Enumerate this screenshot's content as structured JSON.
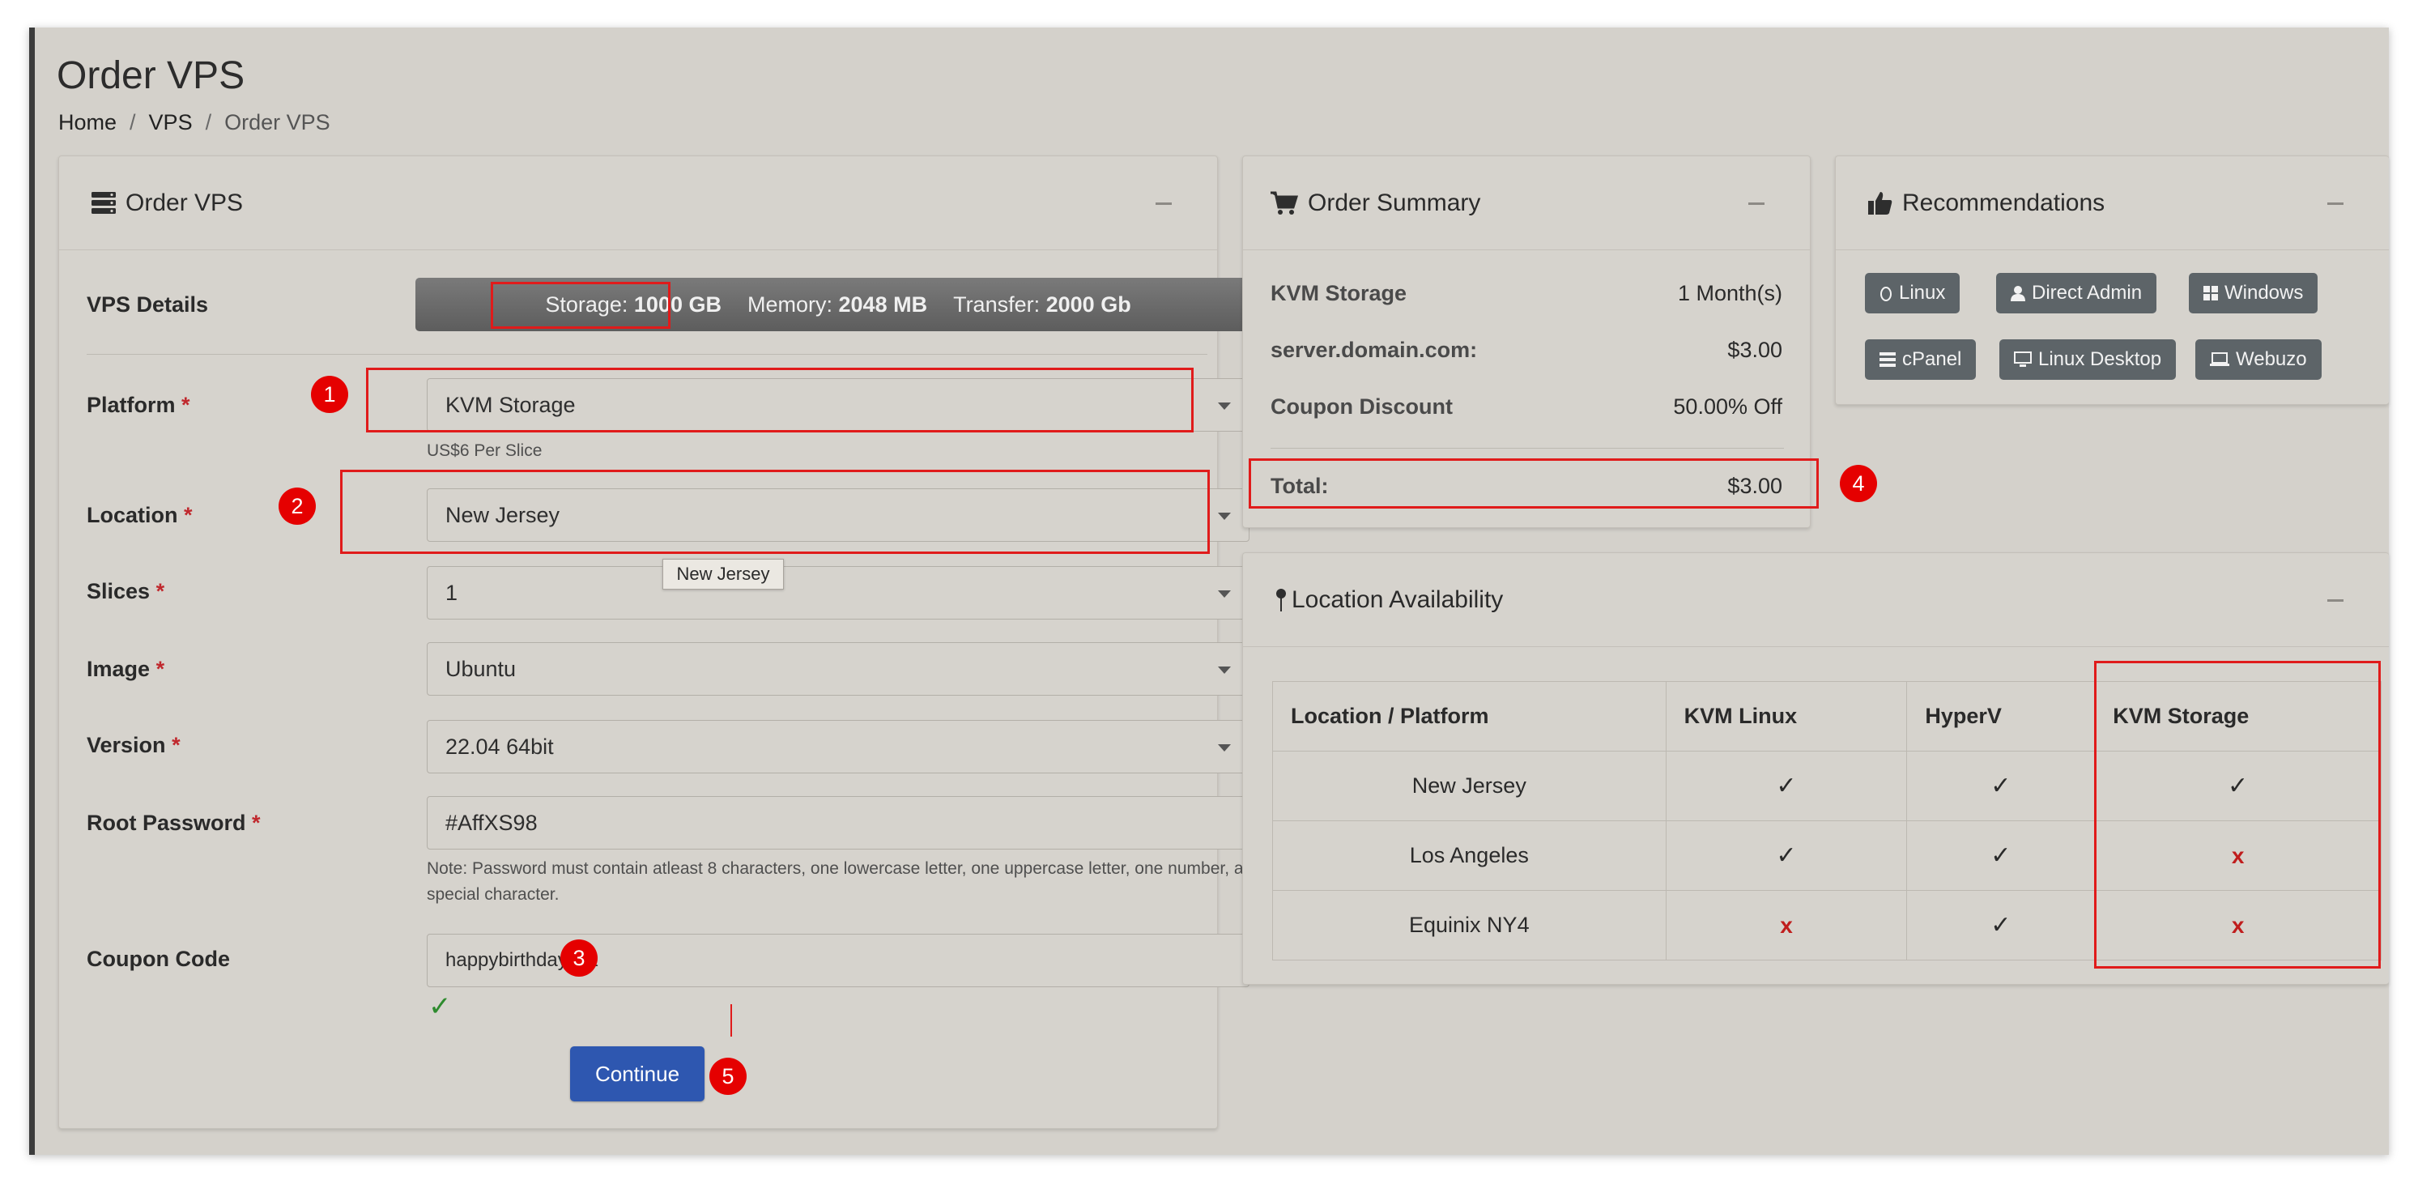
{
  "page": {
    "title": "Order VPS",
    "breadcrumb": [
      "Home",
      "VPS",
      "Order VPS"
    ],
    "breadcrumb_sep": "/"
  },
  "order_card": {
    "title": "Order VPS",
    "vps_details_label": "VPS Details",
    "storage_label": "Storage:",
    "storage_value": "1000 GB",
    "memory_label": "Memory:",
    "memory_value": "2048 MB",
    "transfer_label": "Transfer:",
    "transfer_value": "2000 Gb",
    "required_mark": "*",
    "platform": {
      "label": "Platform",
      "value": "KVM Storage",
      "help": "US$6 Per Slice"
    },
    "location": {
      "label": "Location",
      "value": "New Jersey",
      "tooltip": "New Jersey"
    },
    "slices": {
      "label": "Slices",
      "value": "1"
    },
    "image": {
      "label": "Image",
      "value": "Ubuntu"
    },
    "version": {
      "label": "Version",
      "value": "22.04 64bit"
    },
    "root_password": {
      "label": "Root Password",
      "value": "#AffXS98",
      "note_line1": "Note: Password must contain atleast 8 characters, one lowercase letter, one uppercase letter, one number, a",
      "note_line2": "special character."
    },
    "coupon": {
      "label": "Coupon Code",
      "value": "happybirthdaylala",
      "valid_mark": "✓"
    },
    "continue_label": "Continue"
  },
  "summary_card": {
    "title": "Order Summary",
    "rows": [
      {
        "key": "KVM Storage",
        "value": "1 Month(s)"
      },
      {
        "key": "server.domain.com:",
        "value": "$3.00"
      },
      {
        "key": "Coupon Discount",
        "value": "50.00% Off"
      }
    ],
    "total_key": "Total:",
    "total_value": "$3.00"
  },
  "recommendations_card": {
    "title": "Recommendations",
    "buttons": [
      "Linux",
      "Direct Admin",
      "Windows",
      "cPanel",
      "Linux Desktop",
      "Webuzo"
    ]
  },
  "availability_card": {
    "title": "Location Availability",
    "headers": [
      "Location / Platform",
      "KVM Linux",
      "HyperV",
      "KVM Storage"
    ],
    "rows": [
      {
        "location": "New Jersey",
        "cells": [
          "✓",
          "✓",
          "✓"
        ]
      },
      {
        "location": "Los Angeles",
        "cells": [
          "✓",
          "✓",
          "x"
        ]
      },
      {
        "location": "Equinix NY4",
        "cells": [
          "x",
          "✓",
          "x"
        ]
      }
    ]
  },
  "annotations": [
    "1",
    "2",
    "3",
    "4",
    "5"
  ],
  "colors": {
    "accent": "#2e57b0",
    "highlight": "#e01b1b",
    "required": "#c0282d",
    "ok": "#2e8b2e"
  }
}
